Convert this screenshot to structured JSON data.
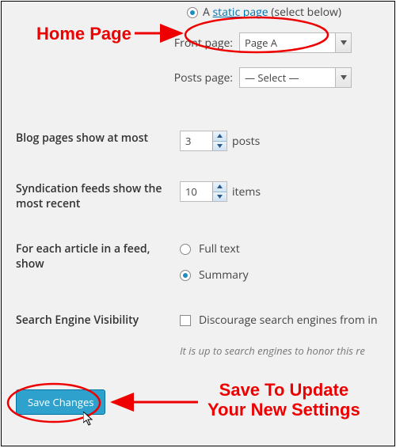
{
  "top": {
    "radio_label_a": "A ",
    "radio_link": "static page",
    "radio_label_b": " (select below)"
  },
  "front": {
    "label": "Front page:",
    "value": "Page A"
  },
  "posts": {
    "label": "Posts page:",
    "value": "— Select —"
  },
  "blog_pages": {
    "label": "Blog pages show at most",
    "value": "3",
    "unit": "posts"
  },
  "syndication": {
    "label": "Syndication feeds show the most recent",
    "value": "10",
    "unit": "items"
  },
  "feed_show": {
    "label": "For each article in a feed, show",
    "opt_full": "Full text",
    "opt_summary": "Summary"
  },
  "sev": {
    "label": "Search Engine Visibility",
    "checkbox": "Discourage search engines from in",
    "hint": "It is up to search engines to honor this re"
  },
  "save": "Save Changes",
  "annotations": {
    "homepage": "Home Page",
    "saveto": "Save To Update\nYour New Settings"
  }
}
